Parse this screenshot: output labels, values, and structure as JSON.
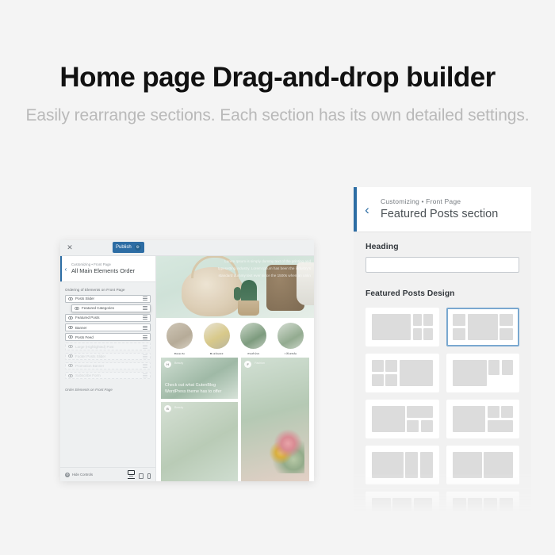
{
  "headline": {
    "title": "Home page Drag-and-drop builder",
    "subtitle": "Easily rearrange sections. Each section has its own detailed settings."
  },
  "customizer_window": {
    "close_label": "✕",
    "publish_label": "Publish",
    "publish_gear_icon": "⚙",
    "back_chevron": "‹",
    "breadcrumb": "Customizing • Front Page",
    "panel_title": "All Main Elements Order",
    "section_label": "Ordering of Elements on Front Page",
    "elements": [
      {
        "label": "Posts Slider",
        "enabled": true,
        "dragging": false
      },
      {
        "label": "Featured Categories",
        "enabled": true,
        "dragging": true
      },
      {
        "label": "Featured Posts",
        "enabled": true,
        "dragging": false
      },
      {
        "label": "Banner",
        "enabled": true,
        "dragging": false
      },
      {
        "label": "Posts Feed",
        "enabled": true,
        "dragging": false
      },
      {
        "label": "Large (Highlighted) Post",
        "enabled": false,
        "dragging": false
      },
      {
        "label": "Footer Posts Slider",
        "enabled": false,
        "dragging": false
      },
      {
        "label": "Promotion Banner",
        "enabled": false,
        "dragging": false
      },
      {
        "label": "Subscribe Form",
        "enabled": false,
        "dragging": false
      }
    ],
    "description": "Order Elements on Front Page",
    "footer": {
      "hide_controls_label": "Hide Controls",
      "hide_controls_icon": "⚙",
      "devices": [
        "desktop",
        "tablet",
        "mobile"
      ],
      "active_device": "desktop"
    }
  },
  "preview": {
    "hero_overlay_text": "Lorem Ipsum is simply dummy text of the printing and typesetting industry. Lorem Ipsum has been the industry's standard dummy text ever since the 1500s when an unkn",
    "categories": [
      "Beauty",
      "Business",
      "Fashion",
      "Lifestyle"
    ],
    "feature_card_title": "Check out what GutenBlog WordPress theme has to offer",
    "card_badges": [
      "H",
      "F",
      "B"
    ],
    "card_taglines": [
      "Beauty",
      "Fashion",
      "Beauty"
    ]
  },
  "section_panel": {
    "back_chevron": "‹",
    "breadcrumb": "Customizing • Front Page",
    "title": "Featured Posts section",
    "heading_label": "Heading",
    "heading_value": "",
    "heading_placeholder": "",
    "design_label": "Featured Posts Design",
    "designs": [
      {
        "id": "design-1",
        "selected": false
      },
      {
        "id": "design-2",
        "selected": true
      },
      {
        "id": "design-3",
        "selected": false
      },
      {
        "id": "design-4",
        "selected": false
      },
      {
        "id": "design-5",
        "selected": false
      },
      {
        "id": "design-6",
        "selected": false
      },
      {
        "id": "design-7",
        "selected": false
      },
      {
        "id": "design-8",
        "selected": false
      },
      {
        "id": "design-9",
        "selected": false
      },
      {
        "id": "design-10",
        "selected": false
      }
    ]
  },
  "colors": {
    "page_background": "#f4f4f4",
    "accent_blue": "#2d6da4",
    "selected_border": "#7aa8d0",
    "headline": "#111111",
    "subhead": "#b9b9b9"
  }
}
